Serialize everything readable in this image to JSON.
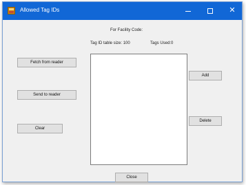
{
  "window": {
    "title": "Allowed Tag IDs",
    "controls": {
      "minimize_icon": "minimize-icon",
      "maximize_icon": "maximize-icon",
      "close_glyph": "✕"
    },
    "titlebar_color": "#1167d6"
  },
  "labels": {
    "facility_code": "For Facility Code:",
    "tag_table_size": "Tag ID table size: 100",
    "tags_used": "Tags Used:0"
  },
  "buttons": {
    "fetch": "Fetch from reader",
    "send": "Send to reader",
    "clear": "Clear",
    "add": "Add",
    "delete": "Delete",
    "close": "Close"
  },
  "tag_list": []
}
